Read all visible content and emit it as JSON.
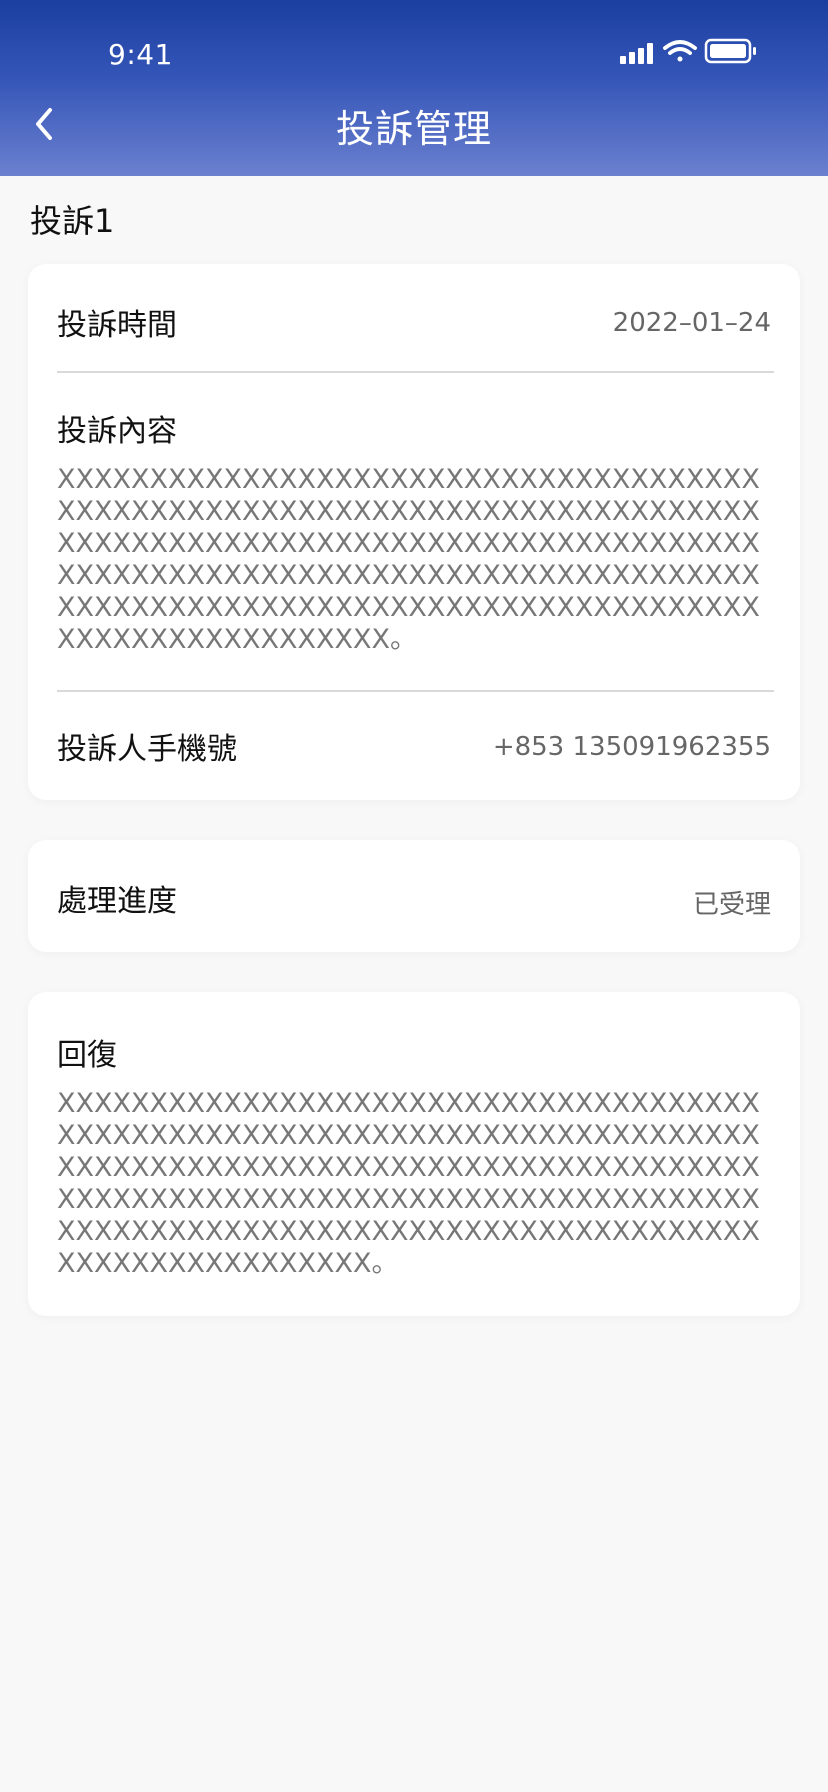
{
  "status_bar": {
    "time": "9:41"
  },
  "nav": {
    "title": "投訴管理"
  },
  "section": {
    "title": "投訴1"
  },
  "complaint_card": {
    "time_label": "投訴時間",
    "time_value": "2022–01–24",
    "content_label": "投訴內容",
    "content_text": "XXXXXXXXXXXXXXXXXXXXXXXXXXXXXXXXXXXXXXXXXXXXXXXXXXXXXXXXXXXXXXXXXXXXXXXXXXXXXXXXXXXXXXXXXXXXXXXXXXXXXXXXXXXXXXXXXXXXXXXXXXXXXXXXXXXXXXXXXXXXXXXXXXXXXXXXXXXXXXXXXXXXXXXXXXXXXXXXXXXXXXXXXXXXXXXXXXXXXXXXXXXXXXXX。",
    "phone_label": "投訴人手機號",
    "phone_value": "+853 135091962355"
  },
  "progress_card": {
    "label": "處理進度",
    "value": "已受理"
  },
  "reply_card": {
    "label": "回復",
    "text": "XXXXXXXXXXXXXXXXXXXXXXXXXXXXXXXXXXXXXXXXXXXXXXXXXXXXXXXXXXXXXXXXXXXXXXXXXXXXXXXXXXXXXXXXXXXXXXXXXXXXXXXXXXXXXXXXXXXXXXXXXXXXXXXXXXXXXXXXXXXXXXXXXXXXXXXXXXXXXXXXXXXXXXXXXXXXXXXXXXXXXXXXXXXXXXXXXXXXXXXXXXXXXXX。"
  },
  "icons": {
    "back": "chevron-left-icon",
    "signal": "cellular-signal-icon",
    "wifi": "wifi-icon",
    "battery": "battery-icon"
  },
  "colors": {
    "header_top": "#1a3fa0",
    "header_bottom": "#6b80cf",
    "background": "#f8f8f8",
    "card": "#ffffff",
    "secondary_text": "#666666"
  }
}
